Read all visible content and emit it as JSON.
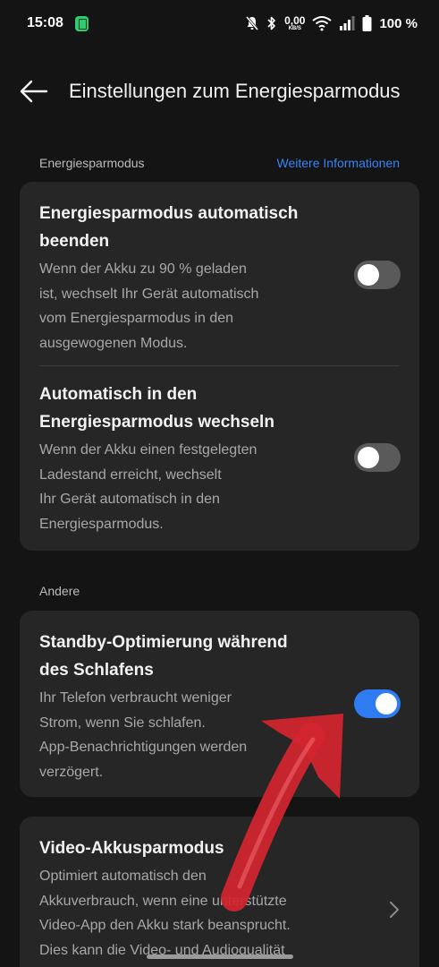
{
  "status_bar": {
    "time": "15:08",
    "net_speed_value": "0,00",
    "net_speed_unit": "KB/S",
    "battery_percent": "100 %"
  },
  "header": {
    "title": "Einstellungen zum Energiesparmodus"
  },
  "section_energy": {
    "label": "Energiesparmodus",
    "link": "Weitere Informationen",
    "items": [
      {
        "title_line1": "Energiesparmodus automatisch",
        "title_line2": "beenden",
        "desc_lines": [
          "Wenn der Akku zu 90 % geladen",
          "ist, wechselt Ihr Gerät automatisch",
          "vom Energiesparmodus in den",
          "ausgewogenen Modus."
        ],
        "toggle_on": false
      },
      {
        "title_line1": "Automatisch in den",
        "title_line2": "Energiesparmodus wechseln",
        "desc_lines": [
          "Wenn der Akku einen festgelegten",
          "Ladestand erreicht, wechselt",
          "Ihr Gerät automatisch in den",
          "Energiesparmodus."
        ],
        "toggle_on": false
      }
    ]
  },
  "section_other": {
    "label": "Andere",
    "standby": {
      "title_line1": "Standby-Optimierung während",
      "title_line2": "des Schlafens",
      "desc_lines": [
        "Ihr Telefon verbraucht weniger",
        "Strom, wenn Sie schlafen.",
        "App-Benachrichtigungen werden",
        "verzögert."
      ],
      "toggle_on": true
    },
    "video": {
      "title": "Video-Akkusparmodus",
      "desc_lines": [
        "Optimiert automatisch den",
        "Akkuverbrauch, wenn eine unterstützte",
        "Video-App den Akku stark beansprucht.",
        "Dies kann die Video- und Audioqualität"
      ]
    }
  },
  "colors": {
    "background": "#141414",
    "card": "#262626",
    "accent": "#2f7bf2",
    "link": "#3b82f6",
    "annotation_arrow": "#e0303a"
  },
  "icons": [
    "battery-notification-icon",
    "mute-icon",
    "bluetooth-icon",
    "wifi-icon",
    "signal-icon",
    "battery-icon",
    "back-arrow-icon",
    "chevron-right-icon"
  ]
}
